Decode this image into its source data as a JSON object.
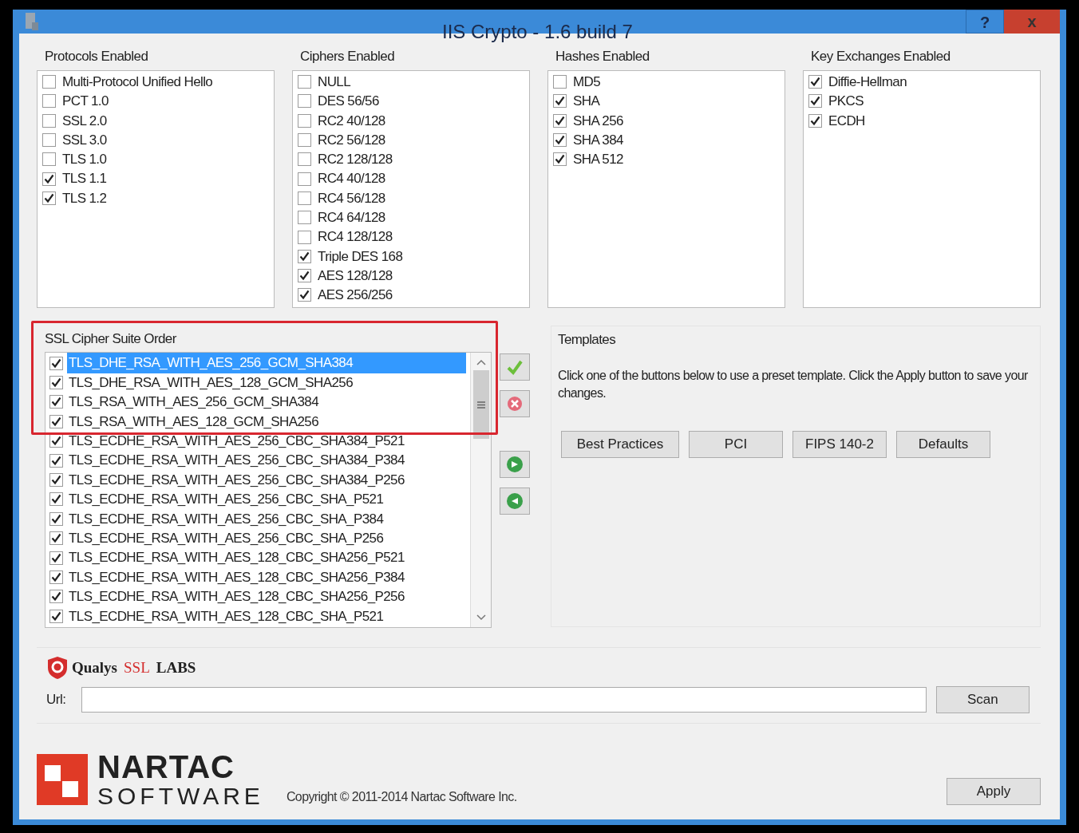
{
  "window": {
    "title": "IIS Crypto - 1.6 build 7",
    "buttons": [
      {
        "kind": "help",
        "label": "?"
      },
      {
        "kind": "close",
        "label": "x"
      }
    ]
  },
  "lists": [
    {
      "title": "Protocols Enabled",
      "items": [
        {
          "label": "Multi-Protocol Unified Hello",
          "checked": false
        },
        {
          "label": "PCT 1.0",
          "checked": false
        },
        {
          "label": "SSL 2.0",
          "checked": false
        },
        {
          "label": "SSL 3.0",
          "checked": false
        },
        {
          "label": "TLS 1.0",
          "checked": false
        },
        {
          "label": "TLS 1.1",
          "checked": true
        },
        {
          "label": "TLS 1.2",
          "checked": true
        }
      ]
    },
    {
      "title": "Ciphers Enabled",
      "items": [
        {
          "label": "NULL",
          "checked": false
        },
        {
          "label": "DES 56/56",
          "checked": false
        },
        {
          "label": "RC2 40/128",
          "checked": false
        },
        {
          "label": "RC2 56/128",
          "checked": false
        },
        {
          "label": "RC2 128/128",
          "checked": false
        },
        {
          "label": "RC4 40/128",
          "checked": false
        },
        {
          "label": "RC4 56/128",
          "checked": false
        },
        {
          "label": "RC4 64/128",
          "checked": false
        },
        {
          "label": "RC4 128/128",
          "checked": false
        },
        {
          "label": "Triple DES 168",
          "checked": true
        },
        {
          "label": "AES 128/128",
          "checked": true
        },
        {
          "label": "AES 256/256",
          "checked": true
        }
      ]
    },
    {
      "title": "Hashes Enabled",
      "items": [
        {
          "label": "MD5",
          "checked": false
        },
        {
          "label": "SHA",
          "checked": true
        },
        {
          "label": "SHA 256",
          "checked": true
        },
        {
          "label": "SHA 384",
          "checked": true
        },
        {
          "label": "SHA 512",
          "checked": true
        }
      ]
    },
    {
      "title": "Key Exchanges Enabled",
      "items": [
        {
          "label": "Diffie-Hellman",
          "checked": true
        },
        {
          "label": "PKCS",
          "checked": true
        },
        {
          "label": "ECDH",
          "checked": true
        }
      ]
    }
  ],
  "cipher_suite_order": {
    "title": "SSL Cipher Suite Order",
    "items": [
      {
        "label": "TLS_DHE_RSA_WITH_AES_256_GCM_SHA384",
        "checked": true,
        "selected": true
      },
      {
        "label": "TLS_DHE_RSA_WITH_AES_128_GCM_SHA256",
        "checked": true,
        "selected": false
      },
      {
        "label": "TLS_RSA_WITH_AES_256_GCM_SHA384",
        "checked": true,
        "selected": false
      },
      {
        "label": "TLS_RSA_WITH_AES_128_GCM_SHA256",
        "checked": true,
        "selected": false
      },
      {
        "label": "TLS_ECDHE_RSA_WITH_AES_256_CBC_SHA384_P521",
        "checked": true,
        "selected": false
      },
      {
        "label": "TLS_ECDHE_RSA_WITH_AES_256_CBC_SHA384_P384",
        "checked": true,
        "selected": false
      },
      {
        "label": "TLS_ECDHE_RSA_WITH_AES_256_CBC_SHA384_P256",
        "checked": true,
        "selected": false
      },
      {
        "label": "TLS_ECDHE_RSA_WITH_AES_256_CBC_SHA_P521",
        "checked": true,
        "selected": false
      },
      {
        "label": "TLS_ECDHE_RSA_WITH_AES_256_CBC_SHA_P384",
        "checked": true,
        "selected": false
      },
      {
        "label": "TLS_ECDHE_RSA_WITH_AES_256_CBC_SHA_P256",
        "checked": true,
        "selected": false
      },
      {
        "label": "TLS_ECDHE_RSA_WITH_AES_128_CBC_SHA256_P521",
        "checked": true,
        "selected": false
      },
      {
        "label": "TLS_ECDHE_RSA_WITH_AES_128_CBC_SHA256_P384",
        "checked": true,
        "selected": false
      },
      {
        "label": "TLS_ECDHE_RSA_WITH_AES_128_CBC_SHA256_P256",
        "checked": true,
        "selected": false
      },
      {
        "label": "TLS_ECDHE_RSA_WITH_AES_128_CBC_SHA_P521",
        "checked": true,
        "selected": false
      }
    ],
    "side_buttons": [
      {
        "kind": "check"
      },
      {
        "kind": "remove"
      },
      {
        "kind": "down"
      },
      {
        "kind": "up"
      }
    ]
  },
  "templates": {
    "title": "Templates",
    "text": "Click one of the buttons below to use a preset template. Click the Apply button to save your changes.",
    "buttons": [
      "Best Practices",
      "PCI",
      "FIPS 140-2",
      "Defaults"
    ]
  },
  "qualys": {
    "logo": [
      "Qualys",
      "SSL",
      "LABS"
    ],
    "url_label": "Url:",
    "scan_button": "Scan"
  },
  "footer": {
    "logo": [
      "NARTAC",
      "SOFTWARE"
    ],
    "copyright": "Copyright © 2011-2014 Nartac Software Inc.",
    "apply_button": "Apply"
  }
}
